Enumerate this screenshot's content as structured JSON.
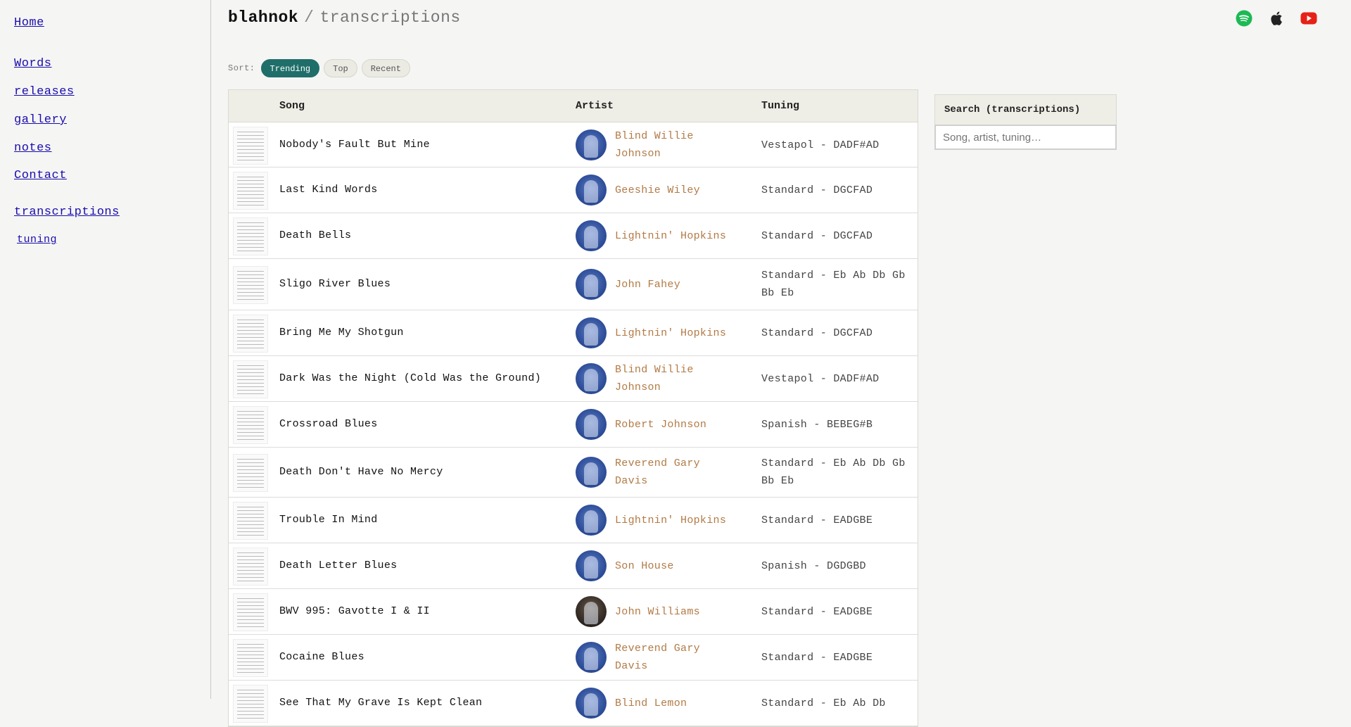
{
  "sidebar": {
    "home": "Home",
    "words": "Words",
    "releases": "releases",
    "gallery": "gallery",
    "notes": "notes",
    "contact": "Contact",
    "transcriptions": "transcriptions",
    "tuning": "tuning"
  },
  "header": {
    "site_name": "blahnok",
    "separator": "/",
    "section": "transcriptions"
  },
  "social_icons": [
    "spotify-icon",
    "apple-icon",
    "youtube-icon"
  ],
  "colors": {
    "accent": "#1f6e6a",
    "artist_link": "#b27a45",
    "spotify": "#1db954",
    "youtube": "#e62117"
  },
  "sort": {
    "label": "Sort:",
    "options": [
      "Trending",
      "Top",
      "Recent"
    ],
    "active": "Trending"
  },
  "table": {
    "headers": {
      "song": "Song",
      "artist": "Artist",
      "tuning": "Tuning"
    },
    "rows": [
      {
        "song": "Nobody's Fault But Mine",
        "artist": "Blind Willie Johnson",
        "tuning": "Vestapol - DADF#AD"
      },
      {
        "song": "Last Kind Words",
        "artist": "Geeshie Wiley",
        "tuning": "Standard - DGCFAD"
      },
      {
        "song": "Death Bells",
        "artist": "Lightnin' Hopkins",
        "tuning": "Standard - DGCFAD"
      },
      {
        "song": "Sligo River Blues",
        "artist": "John Fahey",
        "tuning": "Standard - Eb Ab Db Gb Bb Eb"
      },
      {
        "song": "Bring Me My Shotgun",
        "artist": "Lightnin' Hopkins",
        "tuning": "Standard - DGCFAD"
      },
      {
        "song": "Dark Was the Night (Cold Was the Ground)",
        "artist": "Blind Willie Johnson",
        "tuning": "Vestapol - DADF#AD"
      },
      {
        "song": "Crossroad Blues",
        "artist": "Robert Johnson",
        "tuning": "Spanish - BEBEG#B"
      },
      {
        "song": "Death Don't Have No Mercy",
        "artist": "Reverend Gary Davis",
        "tuning": "Standard - Eb Ab Db Gb Bb Eb"
      },
      {
        "song": "Trouble In Mind",
        "artist": "Lightnin' Hopkins",
        "tuning": "Standard - EADGBE"
      },
      {
        "song": "Death Letter Blues",
        "artist": "Son House",
        "tuning": "Spanish - DGDGBD"
      },
      {
        "song": "BWV 995: Gavotte I & II",
        "artist": "John Williams",
        "tuning": "Standard - EADGBE"
      },
      {
        "song": "Cocaine Blues",
        "artist": "Reverend Gary Davis",
        "tuning": "Standard - EADGBE"
      },
      {
        "song": "See That My Grave Is Kept Clean",
        "artist": "Blind Lemon",
        "tuning": "Standard - Eb Ab Db"
      }
    ]
  },
  "search": {
    "title": "Search (transcriptions)",
    "placeholder": "Song, artist, tuning…"
  }
}
